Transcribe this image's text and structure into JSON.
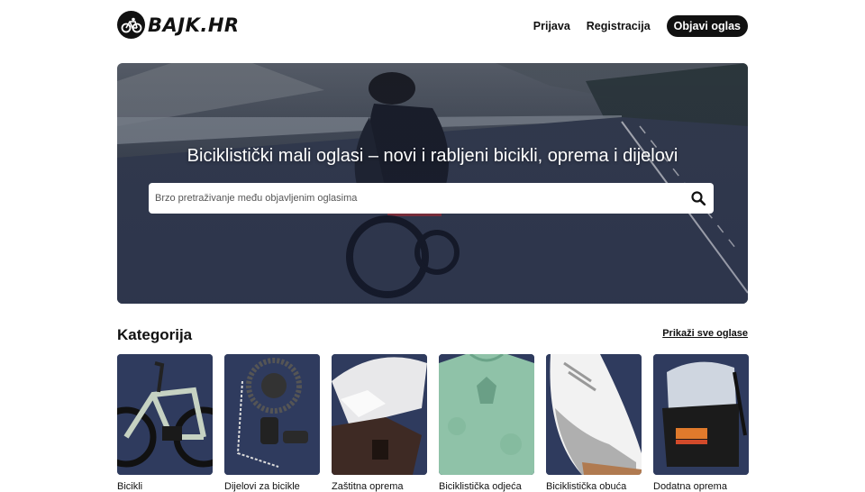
{
  "header": {
    "logo_text": "BAJK.HR",
    "nav": {
      "login": "Prijava",
      "register": "Registracija",
      "publish": "Objavi oglas"
    }
  },
  "hero": {
    "title": "Biciklistički mali oglasi – novi i rabljeni bicikli, oprema i dijelovi",
    "search_placeholder": "Brzo pretraživanje među objavljenim oglasima"
  },
  "categories": {
    "heading": "Kategorija",
    "show_all": "Prikaži sve oglase",
    "items": [
      {
        "label": "Bicikli",
        "icon": "bike-icon"
      },
      {
        "label": "Dijelovi za bicikle",
        "icon": "derailleur-icon"
      },
      {
        "label": "Zaštitna oprema",
        "icon": "helmet-icon"
      },
      {
        "label": "Biciklistička odjeća",
        "icon": "jersey-icon"
      },
      {
        "label": "Biciklistička obuća",
        "icon": "shoe-icon"
      },
      {
        "label": "Dodatna oprema",
        "icon": "backpack-icon"
      }
    ]
  },
  "colors": {
    "primary": "#111111",
    "card_bg": "#2e3a5e",
    "hero_overlay": "#1e2a50"
  }
}
